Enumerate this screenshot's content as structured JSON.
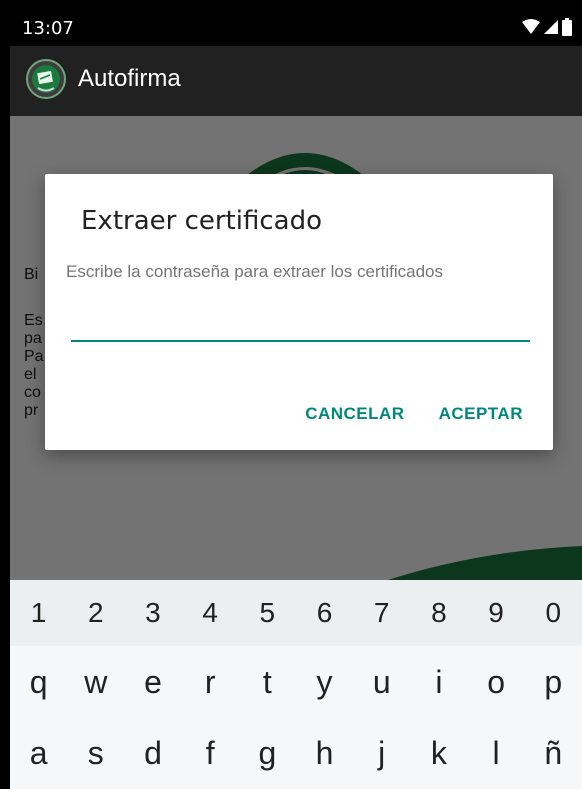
{
  "status_bar": {
    "time": "13:07"
  },
  "app_bar": {
    "title": "Autofirma",
    "logo_icon": "autofirma-logo-icon"
  },
  "background": {
    "text_lines": [
      "Bi",
      "Es",
      "pa",
      "Pa",
      "el",
      "co",
      "pr"
    ]
  },
  "dialog": {
    "title": "Extraer certificado",
    "message": "Escribe la contraseña para extraer los certificados",
    "password_value": "",
    "cancel_label": "CANCELAR",
    "accept_label": "ACEPTAR"
  },
  "keyboard": {
    "numbers": [
      "1",
      "2",
      "3",
      "4",
      "5",
      "6",
      "7",
      "8",
      "9",
      "0"
    ],
    "row_q": [
      "q",
      "w",
      "e",
      "r",
      "t",
      "y",
      "u",
      "i",
      "o",
      "p"
    ],
    "row_a": [
      "a",
      "s",
      "d",
      "f",
      "g",
      "h",
      "j",
      "k",
      "l",
      "ñ"
    ]
  },
  "colors": {
    "accent": "#00897b",
    "app_bar": "#212121",
    "brand_green": "#1b7a3e"
  }
}
